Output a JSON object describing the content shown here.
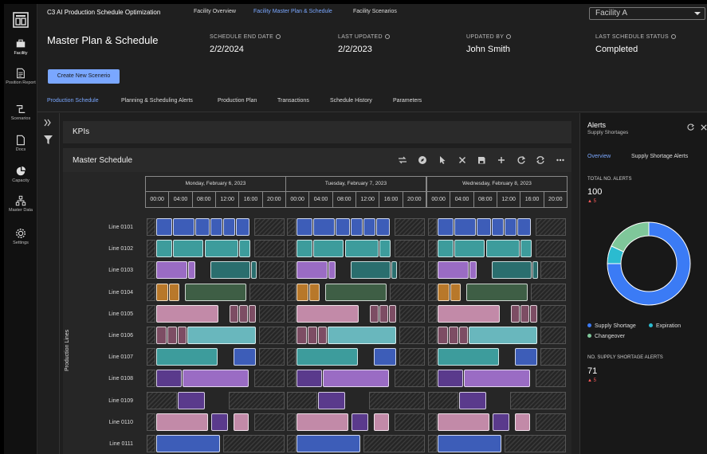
{
  "app": {
    "title": "C3 AI Production Schedule Optimization"
  },
  "top_nav": [
    {
      "label": "Facility Overview",
      "active": false
    },
    {
      "label": "Facility Master Plan & Schedule",
      "active": true
    },
    {
      "label": "Facility Scenarios",
      "active": false
    }
  ],
  "facility_select": {
    "value": "Facility A"
  },
  "left_nav": [
    {
      "label": "Facility",
      "icon": "briefcase-icon",
      "active": true
    },
    {
      "label": "Position Report",
      "icon": "document-icon",
      "active": false
    },
    {
      "label": "Scenarios",
      "icon": "scenario-icon",
      "active": false
    },
    {
      "label": "Docs",
      "icon": "file-icon",
      "active": false
    },
    {
      "label": "Capacity",
      "icon": "pie-icon",
      "active": false
    },
    {
      "label": "Master Data",
      "icon": "hierarchy-icon",
      "active": false
    },
    {
      "label": "Settings",
      "icon": "gear-icon",
      "active": false
    }
  ],
  "page": {
    "title": "Master Plan & Schedule",
    "meta": [
      {
        "key": "SCHEDULE END DATE",
        "value": "2/2/2024"
      },
      {
        "key": "LAST UPDATED",
        "value": "2/2/2023"
      },
      {
        "key": "UPDATED BY",
        "value": "John Smith"
      },
      {
        "key": "LAST SCHEDULE STATUS",
        "value": "Completed"
      }
    ],
    "create_button": "Create New Scenerio"
  },
  "tabs": [
    {
      "label": "Production Schedule",
      "active": true
    },
    {
      "label": "Planning & Scheduling Alerts",
      "active": false
    },
    {
      "label": "Production Plan",
      "active": false
    },
    {
      "label": "Transactions",
      "active": false
    },
    {
      "label": "Schedule History",
      "active": false
    },
    {
      "label": "Parameters",
      "active": false
    }
  ],
  "kpis": {
    "label": "KPIs"
  },
  "schedule": {
    "title": "Master Schedule",
    "toolbar_icons": [
      "shuffle-icon",
      "compass-icon",
      "pointer-icon",
      "close-icon",
      "save-icon",
      "plus-icon",
      "refresh-icon",
      "sync-icon",
      "more-icon"
    ],
    "y_label": "Production Lines",
    "days": [
      "Monday, February 6, 2023",
      "Tuesday, February 7, 2023",
      "Wednesday, February 8, 2023"
    ],
    "hours": [
      "00:00",
      "04:00",
      "08:00",
      "12:00",
      "16:00",
      "20:00"
    ],
    "lines": [
      "Line 0101",
      "Line 0102",
      "Line 0103",
      "Line 0104",
      "Line 0105",
      "Line 0106",
      "Line 0107",
      "Line 0108",
      "Line 0109",
      "Line 0110",
      "Line 0111"
    ],
    "palette": {
      "blue": "#3d5db8",
      "teal": "#3d9c9c",
      "lavender": "#9a6cc4",
      "darkteal": "#2a6e6e",
      "orange": "#b8782a",
      "olive": "#3e5e45",
      "pink": "#c28aa8",
      "mauve": "#7d4d64",
      "sky": "#69b7bd",
      "violet": "#5a3a8c",
      "magenta": "#8e4a78"
    },
    "rows": [
      [
        [
          0,
          1.6,
          "h"
        ],
        [
          1.6,
          4.6,
          "blue"
        ],
        [
          4.6,
          8.4,
          "blue"
        ],
        [
          8.4,
          11.0,
          "blue"
        ],
        [
          11.0,
          13.2,
          "blue"
        ],
        [
          13.2,
          15.4,
          "blue"
        ],
        [
          15.4,
          18.0,
          "blue"
        ],
        [
          18.6,
          24,
          "h"
        ]
      ],
      [
        [
          0,
          1.6,
          "h"
        ],
        [
          1.6,
          4.6,
          "teal"
        ],
        [
          4.6,
          10.0,
          "teal"
        ],
        [
          10.0,
          16.0,
          "teal"
        ],
        [
          16.0,
          18.0,
          "teal"
        ],
        [
          18.6,
          24,
          "h"
        ]
      ],
      [
        [
          0,
          1.6,
          "h"
        ],
        [
          1.6,
          7.2,
          "lavender"
        ],
        [
          7.2,
          8.6,
          "lavender"
        ],
        [
          11.0,
          18.0,
          "darkteal"
        ],
        [
          18.0,
          19.2,
          "darkteal"
        ],
        [
          19.4,
          24,
          "h"
        ]
      ],
      [
        [
          0,
          1.6,
          "h"
        ],
        [
          1.6,
          3.8,
          "orange"
        ],
        [
          3.8,
          5.8,
          "orange"
        ],
        [
          6.6,
          17.4,
          "olive"
        ],
        [
          17.8,
          24,
          "h"
        ]
      ],
      [
        [
          0,
          1.6,
          "h"
        ],
        [
          1.6,
          12.6,
          "pink"
        ],
        [
          14.4,
          16.0,
          "mauve"
        ],
        [
          16.0,
          17.6,
          "mauve"
        ],
        [
          17.6,
          19.0,
          "mauve"
        ],
        [
          19.4,
          24,
          "h"
        ]
      ],
      [
        [
          0,
          1.6,
          "h"
        ],
        [
          1.6,
          3.6,
          "mauve"
        ],
        [
          3.6,
          5.4,
          "mauve"
        ],
        [
          5.4,
          7.0,
          "mauve"
        ],
        [
          7.0,
          19.0,
          "sky"
        ],
        [
          19.4,
          24,
          "h"
        ]
      ],
      [
        [
          0,
          1.6,
          "h"
        ],
        [
          1.6,
          12.4,
          "teal"
        ],
        [
          15.0,
          19.0,
          "blue"
        ],
        [
          19.4,
          24,
          "h"
        ]
      ],
      [
        [
          0,
          1.6,
          "h"
        ],
        [
          1.6,
          6.2,
          "violet"
        ],
        [
          6.2,
          17.8,
          "lavender"
        ],
        [
          18.6,
          24,
          "h"
        ]
      ],
      [
        [
          0,
          5.4,
          "h"
        ],
        [
          5.4,
          10.2,
          "violet"
        ],
        [
          14.2,
          24,
          "h"
        ]
      ],
      [
        [
          0,
          1.6,
          "h"
        ],
        [
          1.6,
          10.8,
          "pink"
        ],
        [
          11.2,
          14.2,
          "violet"
        ],
        [
          15.0,
          17.8,
          "pink"
        ],
        [
          18.6,
          24,
          "h"
        ]
      ],
      [
        [
          0,
          1.6,
          "h"
        ],
        [
          1.6,
          12.8,
          "blue"
        ],
        [
          13.2,
          24,
          "h"
        ]
      ]
    ]
  },
  "alerts": {
    "title": "Alerts",
    "subtitle": "Supply Shortages",
    "tabs": [
      {
        "label": "Overview",
        "active": true
      },
      {
        "label": "Supply Shortage Alerts",
        "active": false
      }
    ],
    "total_label": "TOTAL NO. ALERTS",
    "total_value": "100",
    "total_delta": "5",
    "donut": [
      {
        "name": "Supply Shortage",
        "value": 75,
        "color": "#3b7bf5"
      },
      {
        "name": "Expiration",
        "value": 7,
        "color": "#2bbbd0"
      },
      {
        "name": "Changeover",
        "value": 18,
        "color": "#7fc79a"
      }
    ],
    "supply_label": "NO. SUPPLY SHORTAGE ALERTS",
    "supply_value": "71",
    "supply_delta": "5"
  }
}
